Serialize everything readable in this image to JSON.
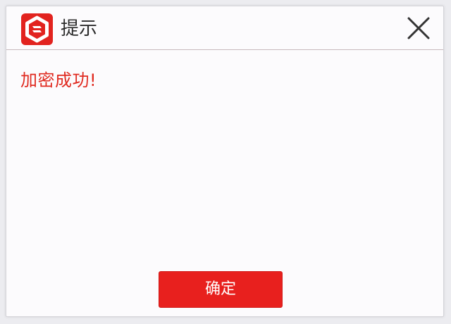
{
  "dialog": {
    "title": "提示",
    "app_icon": "brand-shield-logo-icon",
    "close_icon": "close-x-icon",
    "message": "加密成功!",
    "ok_label": "确定"
  },
  "colors": {
    "accent": "#e8201e",
    "message_text": "#e02a20",
    "title_text": "#2b2b2b"
  }
}
